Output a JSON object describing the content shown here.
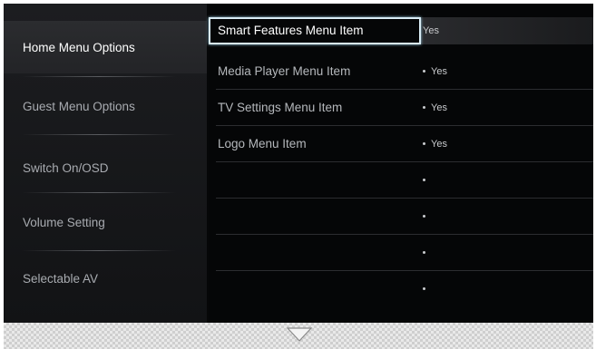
{
  "left_menu": {
    "items": [
      {
        "label": "Home Menu Options",
        "active": true
      },
      {
        "label": "Guest Menu Options",
        "active": false
      },
      {
        "label": "Switch On/OSD",
        "active": false
      },
      {
        "label": "Volume Setting",
        "active": false
      },
      {
        "label": "Selectable AV",
        "active": false
      }
    ]
  },
  "right_list": {
    "rows": [
      {
        "label": "Smart Features Menu Item",
        "value": "Yes",
        "selected": true
      },
      {
        "label": "Media Player Menu Item",
        "value": "Yes",
        "selected": false
      },
      {
        "label": "TV Settings Menu Item",
        "value": "Yes",
        "selected": false
      },
      {
        "label": "Logo Menu Item",
        "value": "Yes",
        "selected": false
      },
      {
        "label": "",
        "value": "",
        "selected": false
      },
      {
        "label": "",
        "value": "",
        "selected": false
      },
      {
        "label": "",
        "value": "",
        "selected": false
      },
      {
        "label": "",
        "value": "",
        "selected": false
      }
    ]
  },
  "footer": {
    "scroll_icon": "chevron-down-icon"
  }
}
